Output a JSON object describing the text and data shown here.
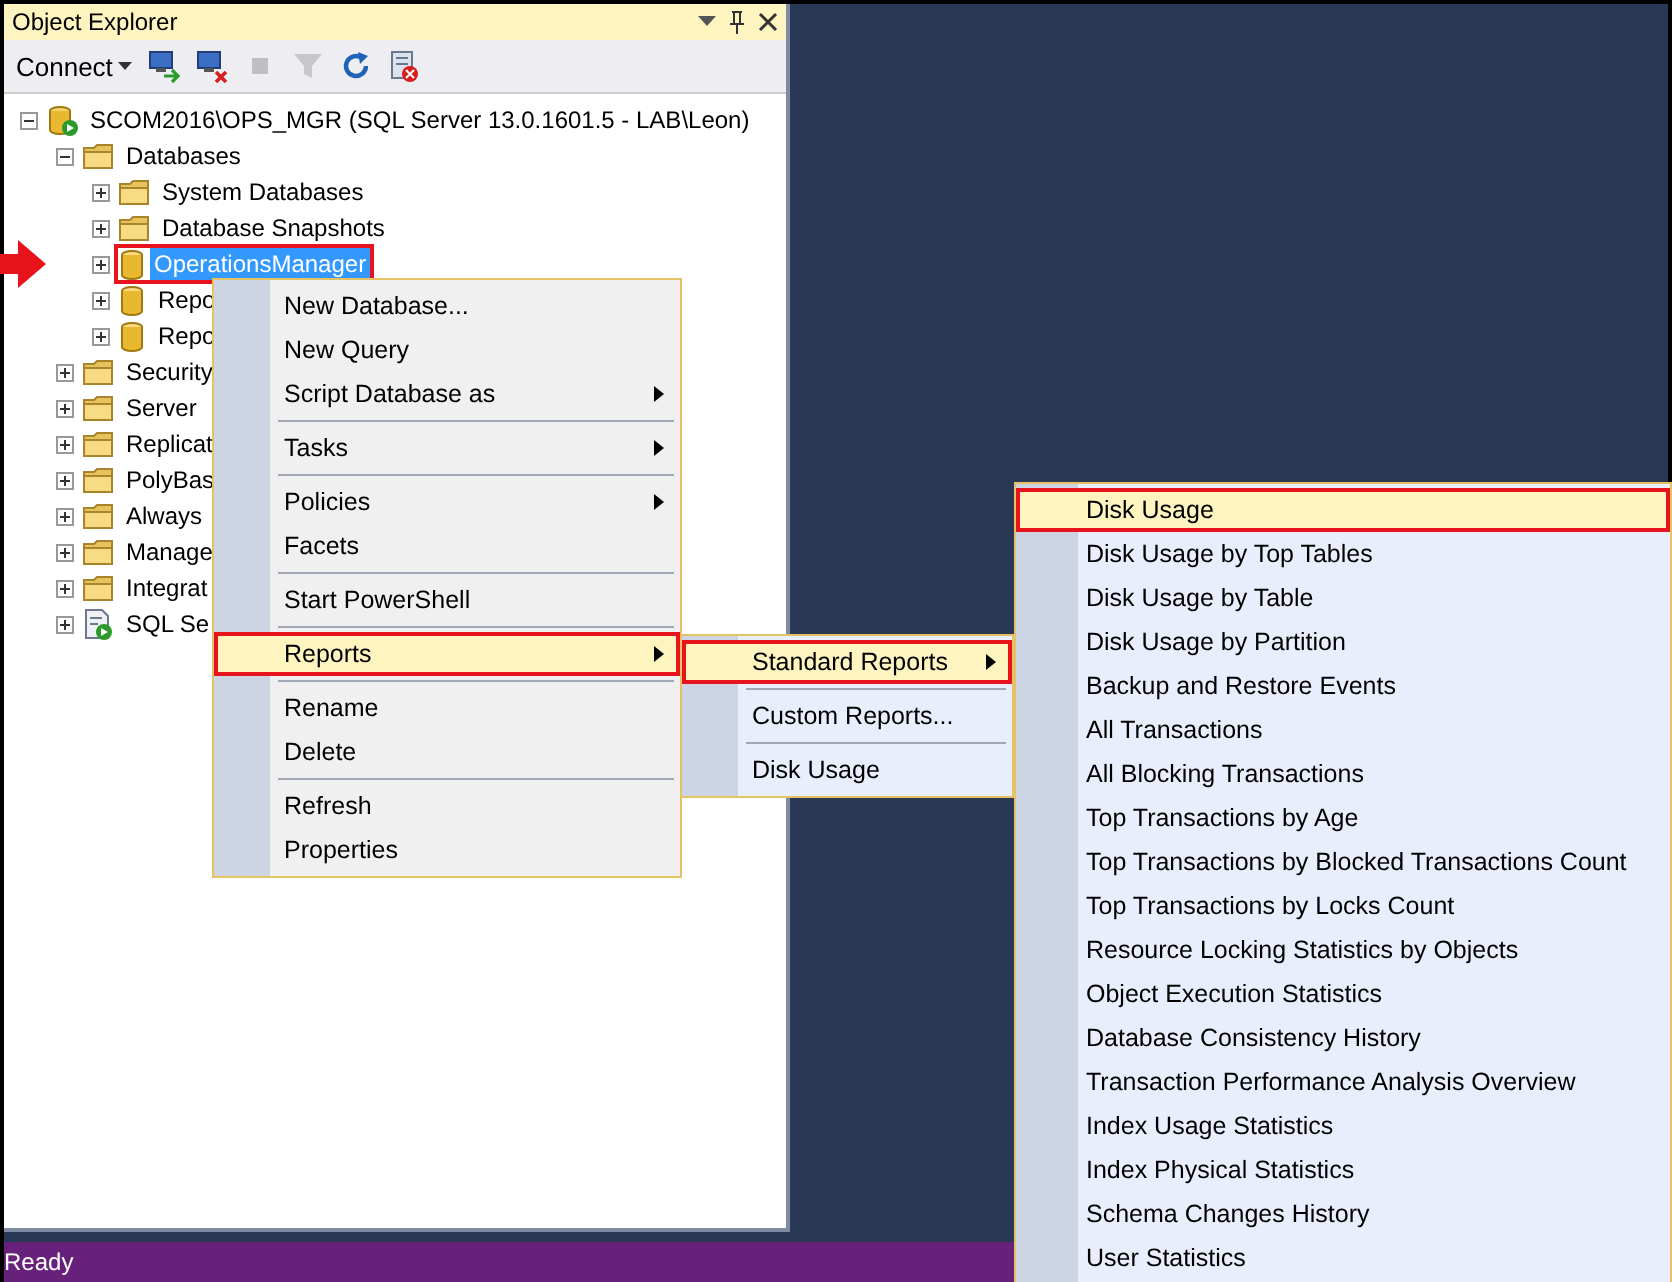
{
  "panel": {
    "title": "Object Explorer"
  },
  "toolbar": {
    "connect_label": "Connect",
    "buttons": [
      {
        "kind": "connect",
        "disabled": false
      },
      {
        "kind": "disconnect",
        "disabled": false
      },
      {
        "kind": "stop",
        "disabled": true
      },
      {
        "kind": "filter",
        "disabled": true
      },
      {
        "kind": "refresh",
        "disabled": false
      },
      {
        "kind": "script",
        "disabled": false
      }
    ]
  },
  "tree": [
    {
      "label": "SCOM2016\\OPS_MGR (SQL Server 13.0.1601.5 - LAB\\Leon)",
      "kind": "server",
      "expanded": true,
      "selected": false,
      "outlined": false,
      "pointer": false,
      "children": [
        {
          "label": "Databases",
          "kind": "folder",
          "expanded": true,
          "selected": false,
          "outlined": false,
          "pointer": false,
          "children": [
            {
              "label": "System Databases",
              "kind": "folder",
              "expanded": false,
              "selected": false,
              "outlined": false,
              "pointer": false
            },
            {
              "label": "Database Snapshots",
              "kind": "folder",
              "expanded": false,
              "selected": false,
              "outlined": false,
              "pointer": false
            },
            {
              "label": "OperationsManager",
              "kind": "database",
              "expanded": false,
              "selected": true,
              "outlined": true,
              "pointer": true
            },
            {
              "label": "Repo",
              "kind": "database",
              "expanded": false,
              "selected": false,
              "outlined": false,
              "pointer": false
            },
            {
              "label": "Repo",
              "kind": "database",
              "expanded": false,
              "selected": false,
              "outlined": false,
              "pointer": false
            }
          ]
        },
        {
          "label": "Security",
          "kind": "folder",
          "expanded": false,
          "selected": false,
          "outlined": false,
          "pointer": false
        },
        {
          "label": "Server",
          "kind": "folder",
          "expanded": false,
          "selected": false,
          "outlined": false,
          "pointer": false
        },
        {
          "label": "Replicat",
          "kind": "folder",
          "expanded": false,
          "selected": false,
          "outlined": false,
          "pointer": false
        },
        {
          "label": "PolyBas",
          "kind": "folder",
          "expanded": false,
          "selected": false,
          "outlined": false,
          "pointer": false
        },
        {
          "label": "Always",
          "kind": "folder",
          "expanded": false,
          "selected": false,
          "outlined": false,
          "pointer": false
        },
        {
          "label": "Manage",
          "kind": "folder",
          "expanded": false,
          "selected": false,
          "outlined": false,
          "pointer": false
        },
        {
          "label": "Integrat",
          "kind": "folder",
          "expanded": false,
          "selected": false,
          "outlined": false,
          "pointer": false
        },
        {
          "label": "SQL Se",
          "kind": "agent",
          "expanded": false,
          "selected": false,
          "outlined": false,
          "pointer": false
        }
      ]
    }
  ],
  "context_menu": {
    "items": [
      {
        "kind": "item",
        "label": "New Database...",
        "has_submenu": false,
        "highlighted": false
      },
      {
        "kind": "item",
        "label": "New Query",
        "has_submenu": false,
        "highlighted": false
      },
      {
        "kind": "item",
        "label": "Script Database as",
        "has_submenu": true,
        "highlighted": false
      },
      {
        "kind": "separator"
      },
      {
        "kind": "item",
        "label": "Tasks",
        "has_submenu": true,
        "highlighted": false
      },
      {
        "kind": "separator"
      },
      {
        "kind": "item",
        "label": "Policies",
        "has_submenu": true,
        "highlighted": false
      },
      {
        "kind": "item",
        "label": "Facets",
        "has_submenu": false,
        "highlighted": false
      },
      {
        "kind": "separator"
      },
      {
        "kind": "item",
        "label": "Start PowerShell",
        "has_submenu": false,
        "highlighted": false
      },
      {
        "kind": "separator"
      },
      {
        "kind": "item",
        "label": "Reports",
        "has_submenu": true,
        "highlighted": true
      },
      {
        "kind": "separator"
      },
      {
        "kind": "item",
        "label": "Rename",
        "has_submenu": false,
        "highlighted": false
      },
      {
        "kind": "item",
        "label": "Delete",
        "has_submenu": false,
        "highlighted": false
      },
      {
        "kind": "separator"
      },
      {
        "kind": "item",
        "label": "Refresh",
        "has_submenu": false,
        "highlighted": false
      },
      {
        "kind": "item",
        "label": "Properties",
        "has_submenu": false,
        "highlighted": false
      }
    ]
  },
  "reports_menu": {
    "items": [
      {
        "kind": "item",
        "label": "Standard Reports",
        "has_submenu": true,
        "highlighted": true
      },
      {
        "kind": "separator"
      },
      {
        "kind": "item",
        "label": "Custom Reports...",
        "has_submenu": false,
        "highlighted": false
      },
      {
        "kind": "separator"
      },
      {
        "kind": "item",
        "label": "Disk Usage",
        "has_submenu": false,
        "highlighted": false
      }
    ]
  },
  "standard_reports_menu": {
    "items": [
      {
        "kind": "item",
        "label": "Disk Usage",
        "has_submenu": false,
        "highlighted": true
      },
      {
        "kind": "item",
        "label": "Disk Usage by Top Tables",
        "has_submenu": false,
        "highlighted": false
      },
      {
        "kind": "item",
        "label": "Disk Usage by Table",
        "has_submenu": false,
        "highlighted": false
      },
      {
        "kind": "item",
        "label": "Disk Usage by Partition",
        "has_submenu": false,
        "highlighted": false
      },
      {
        "kind": "item",
        "label": "Backup and Restore Events",
        "has_submenu": false,
        "highlighted": false
      },
      {
        "kind": "item",
        "label": "All Transactions",
        "has_submenu": false,
        "highlighted": false
      },
      {
        "kind": "item",
        "label": "All Blocking Transactions",
        "has_submenu": false,
        "highlighted": false
      },
      {
        "kind": "item",
        "label": "Top Transactions by Age",
        "has_submenu": false,
        "highlighted": false
      },
      {
        "kind": "item",
        "label": "Top Transactions by Blocked Transactions Count",
        "has_submenu": false,
        "highlighted": false
      },
      {
        "kind": "item",
        "label": "Top Transactions by Locks Count",
        "has_submenu": false,
        "highlighted": false
      },
      {
        "kind": "item",
        "label": "Resource Locking Statistics by Objects",
        "has_submenu": false,
        "highlighted": false
      },
      {
        "kind": "item",
        "label": "Object Execution Statistics",
        "has_submenu": false,
        "highlighted": false
      },
      {
        "kind": "item",
        "label": "Database Consistency History",
        "has_submenu": false,
        "highlighted": false
      },
      {
        "kind": "item",
        "label": "Transaction Performance Analysis Overview",
        "has_submenu": false,
        "highlighted": false
      },
      {
        "kind": "item",
        "label": "Index Usage Statistics",
        "has_submenu": false,
        "highlighted": false
      },
      {
        "kind": "item",
        "label": "Index Physical Statistics",
        "has_submenu": false,
        "highlighted": false
      },
      {
        "kind": "item",
        "label": "Schema Changes History",
        "has_submenu": false,
        "highlighted": false
      },
      {
        "kind": "item",
        "label": "User Statistics",
        "has_submenu": false,
        "highlighted": false
      }
    ]
  },
  "status_bar": {
    "text": "Ready"
  }
}
